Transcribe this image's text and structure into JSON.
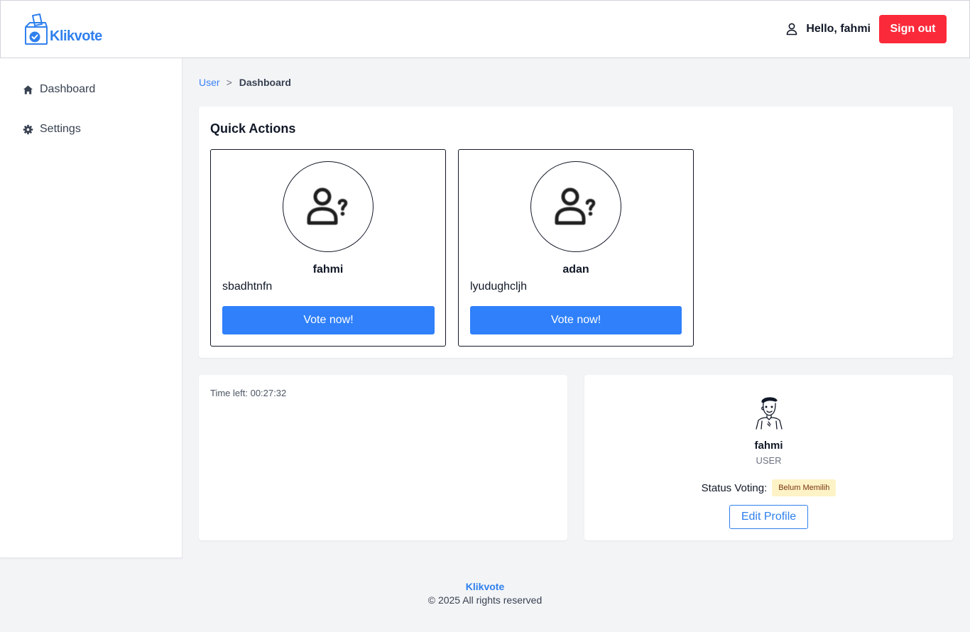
{
  "header": {
    "brand": "Klikvote",
    "greeting": "Hello, fahmi",
    "signout_label": "Sign out",
    "user_icon": "user-icon"
  },
  "sidebar": {
    "items": [
      {
        "label": "Dashboard",
        "icon": "home-icon"
      },
      {
        "label": "Settings",
        "icon": "gear-icon"
      }
    ]
  },
  "breadcrumb": {
    "parent": "User",
    "separator": ">",
    "current": "Dashboard"
  },
  "quick_actions": {
    "title": "Quick Actions",
    "candidates": [
      {
        "name": "fahmi",
        "description": "sbadhtnfn",
        "vote_label": "Vote now!",
        "icon": "unknown-user-icon"
      },
      {
        "name": "adan",
        "description": "lyudughcljh",
        "vote_label": "Vote now!",
        "icon": "unknown-user-icon"
      }
    ]
  },
  "timer": {
    "text": "Time left: 00:27:32"
  },
  "profile": {
    "name": "fahmi",
    "role": "USER",
    "status_label": "Status Voting:",
    "status_value": "Belum Memilih",
    "edit_label": "Edit Profile"
  },
  "footer": {
    "brand": "Klikvote",
    "copyright": "© 2025 All rights reserved"
  },
  "colors": {
    "brand": "#2f80ed",
    "signout": "#fb2a3a",
    "vote_button": "#2f80fa",
    "status_badge_bg": "#fef3c7"
  }
}
